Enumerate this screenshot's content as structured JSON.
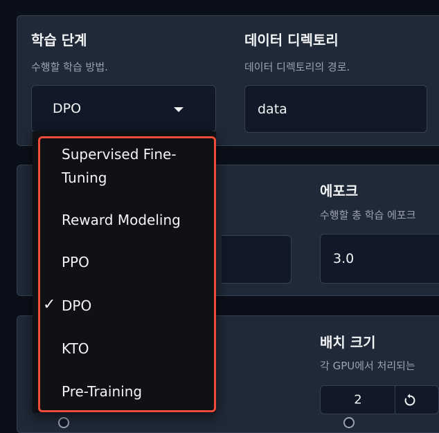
{
  "stage": {
    "label": "학습 단계",
    "description": "수행할 학습 방법.",
    "selected": "DPO",
    "options": [
      "Supervised Fine-Tuning",
      "Reward Modeling",
      "PPO",
      "DPO",
      "KTO",
      "Pre-Training"
    ],
    "option_lines": {
      "sft_line1": "Supervised Fine-",
      "sft_line2": "Tuning"
    }
  },
  "dataset_dir": {
    "label": "데이터 디렉토리",
    "description": "데이터 디렉토리의 경로.",
    "value": "data"
  },
  "epochs": {
    "label": "에포크",
    "description": "수행할 총 학습 에포크",
    "value": "3.0"
  },
  "batch_size": {
    "label": "배치 크기",
    "description": "각 GPU에서 처리되는",
    "value": "2"
  },
  "highlight_color": "#ef4d37",
  "checkmark": "✓"
}
